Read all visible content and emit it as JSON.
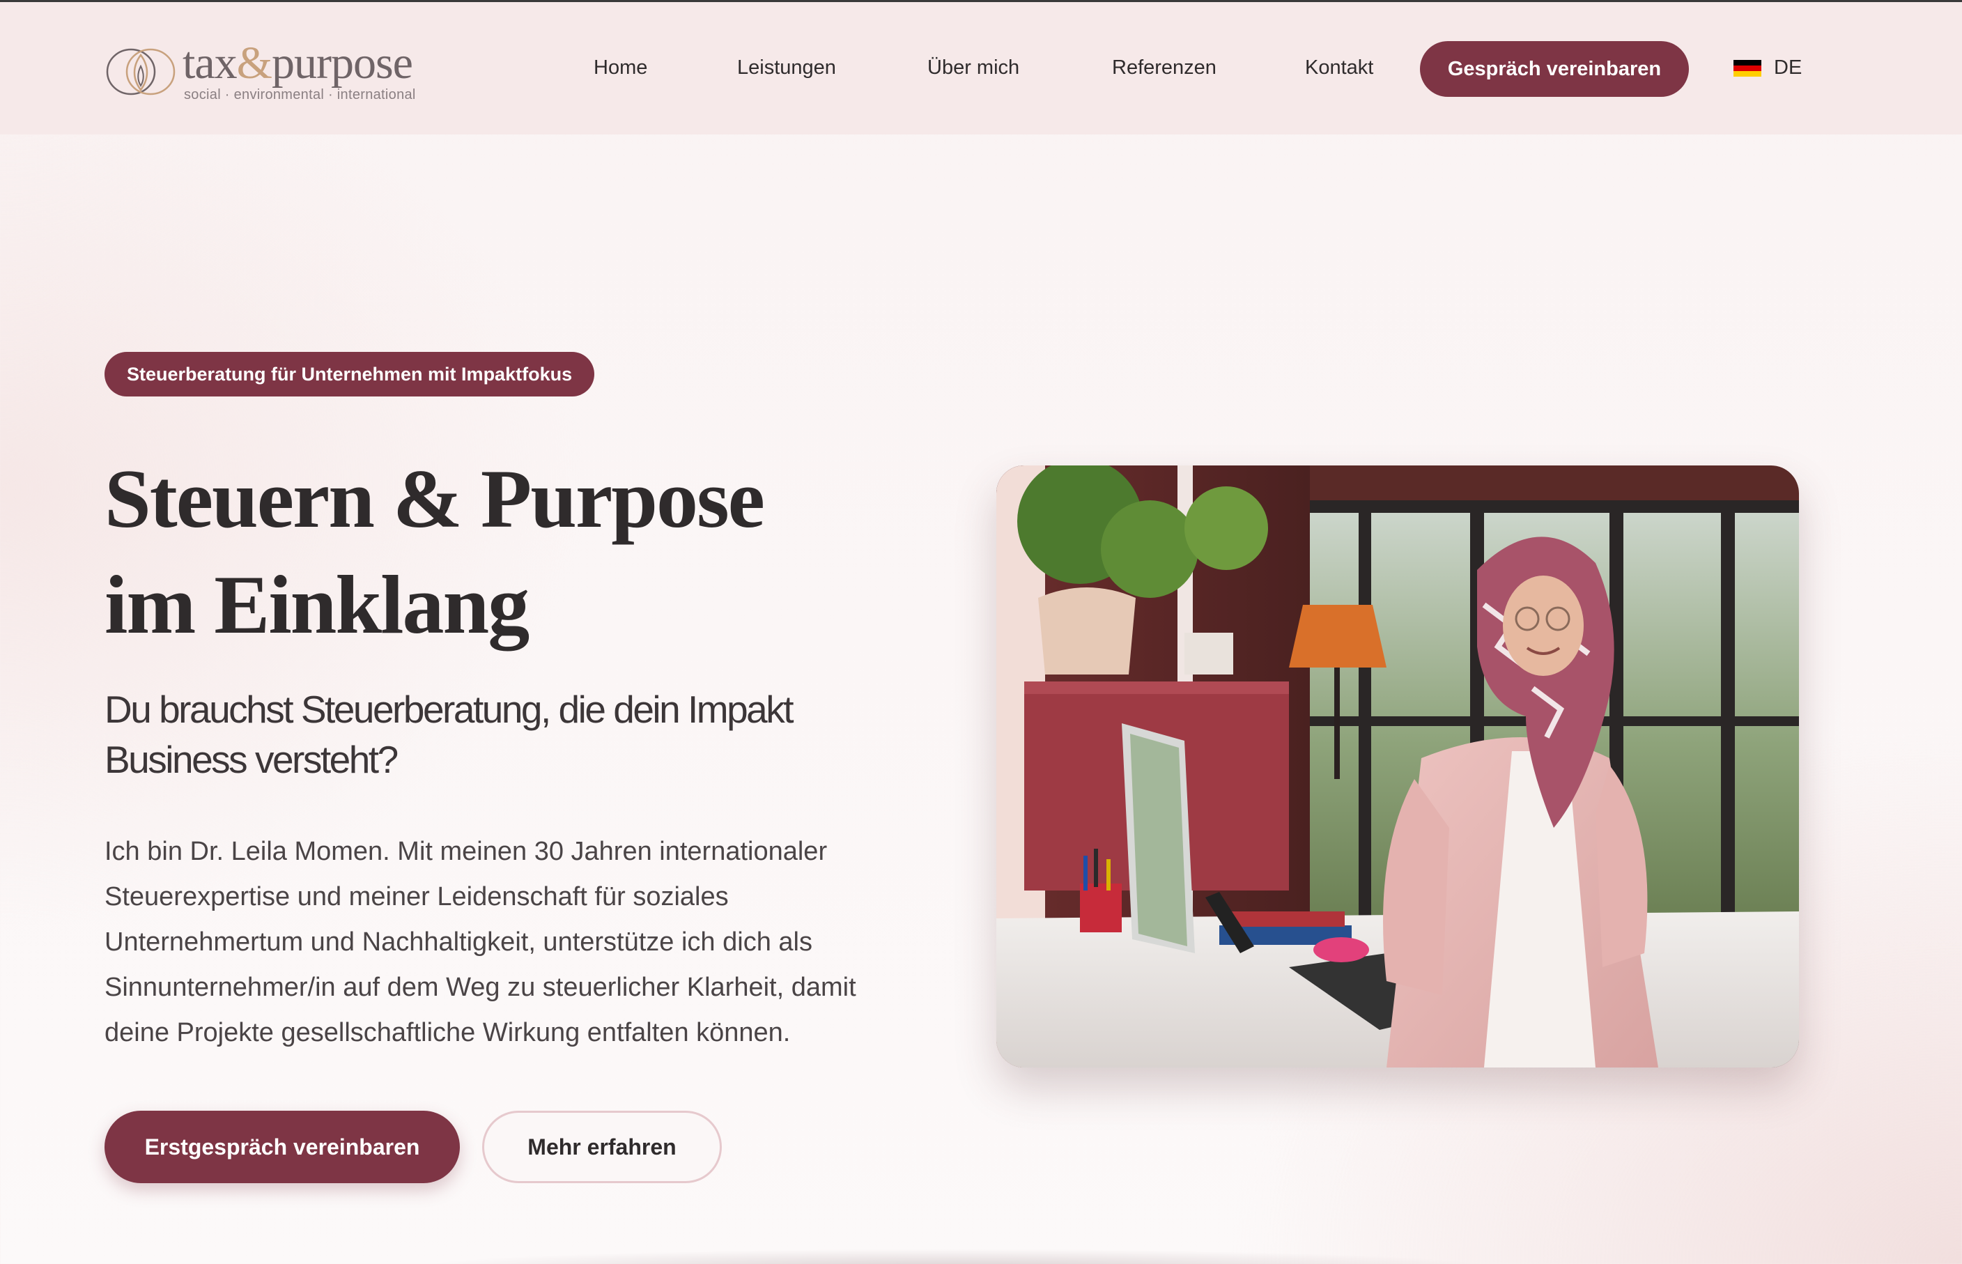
{
  "header": {
    "logo": {
      "wordmark_left": "tax",
      "wordmark_amp": "&",
      "wordmark_right": "purpose",
      "tagline": "social · environmental · international"
    },
    "nav": [
      "Home",
      "Leistungen",
      "Über mich",
      "Referenzen",
      "Kontakt"
    ],
    "cta_label": "Gespräch vereinbaren",
    "language": {
      "label": "DE",
      "flag_icon": "german-flag-icon"
    }
  },
  "hero": {
    "badge": "Steuerberatung für Unternehmen mit Impaktfokus",
    "title_line1": "Steuern & Purpose",
    "title_line2": "im Einklang",
    "subtitle": "Du brauchst Steuerberatung, die dein Impakt Business versteht?",
    "body": "Ich bin Dr. Leila Momen. Mit meinen 30 Jahren internationaler Steuerexpertise und meiner Leidenschaft für soziales Unternehmertum und Nachhaltigkeit, unterstütze ich dich als Sinnunternehmer/in auf dem Weg zu steuerlicher Klarheit, damit deine Projekte gesellschaftliche Wirkung entfalten können.",
    "primary_button": "Erstgespräch vereinbaren",
    "secondary_button": "Mehr erfahren"
  },
  "colors": {
    "accent": "#7e3545",
    "header_bg": "#f6e9e9",
    "text": "#2f2b2c",
    "logo_gold": "#c8a17d"
  }
}
